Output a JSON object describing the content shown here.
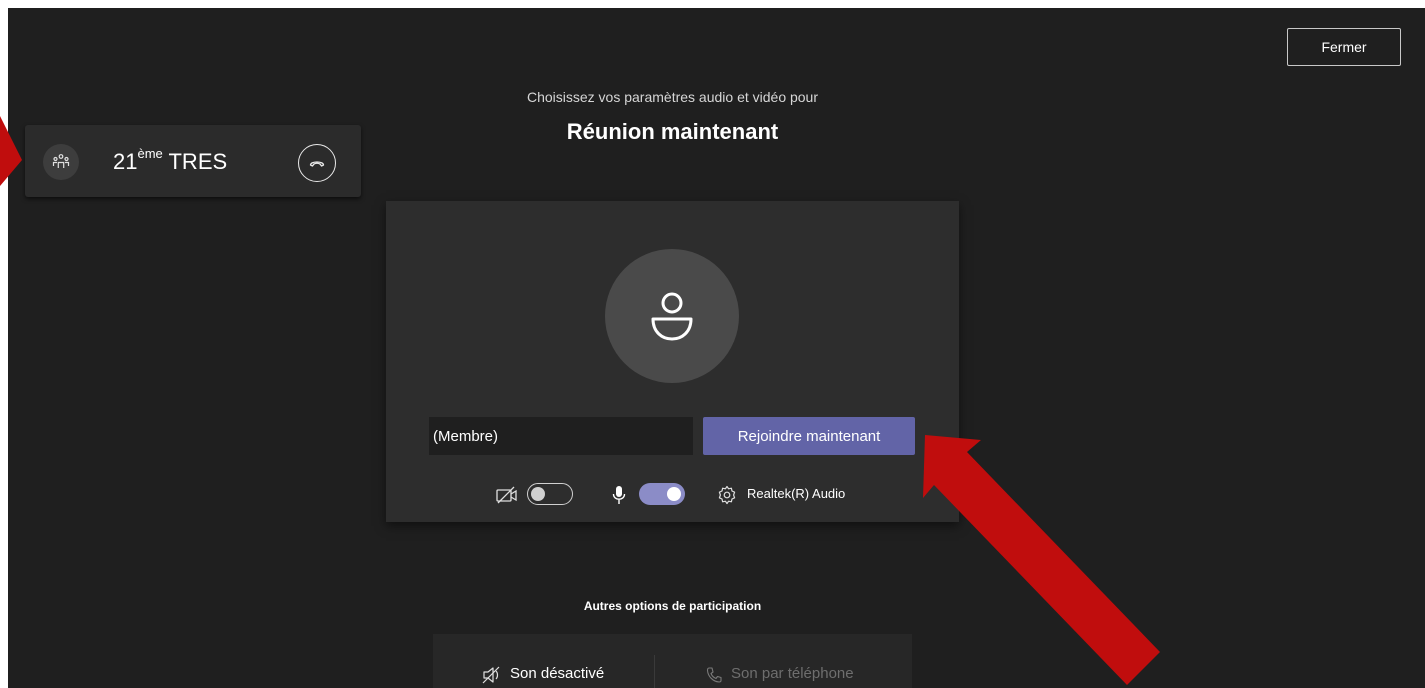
{
  "header": {
    "close_label": "Fermer",
    "subtitle": "Choisissez vos paramètres audio et vidéo pour",
    "meeting_title": "Réunion maintenant"
  },
  "call_pill": {
    "name_prefix": "21",
    "name_sup": "ème",
    "name_suffix": " TRES",
    "icons": [
      "people-group-icon",
      "hang-up-icon"
    ]
  },
  "prejoin": {
    "name_value": "(Membre)",
    "join_label": "Rejoindre maintenant",
    "camera_on": false,
    "mic_on": true,
    "device_label": "Realtek(R) Audio"
  },
  "other_options": {
    "title": "Autres options de participation",
    "sound_off_label": "Son désactivé",
    "phone_audio_label": "Son par téléphone"
  },
  "colors": {
    "background": "#1f1f1f",
    "primary": "#6264a7",
    "toggle_on": "#8b8cc7",
    "annotation_arrow": "#c00d0d"
  }
}
